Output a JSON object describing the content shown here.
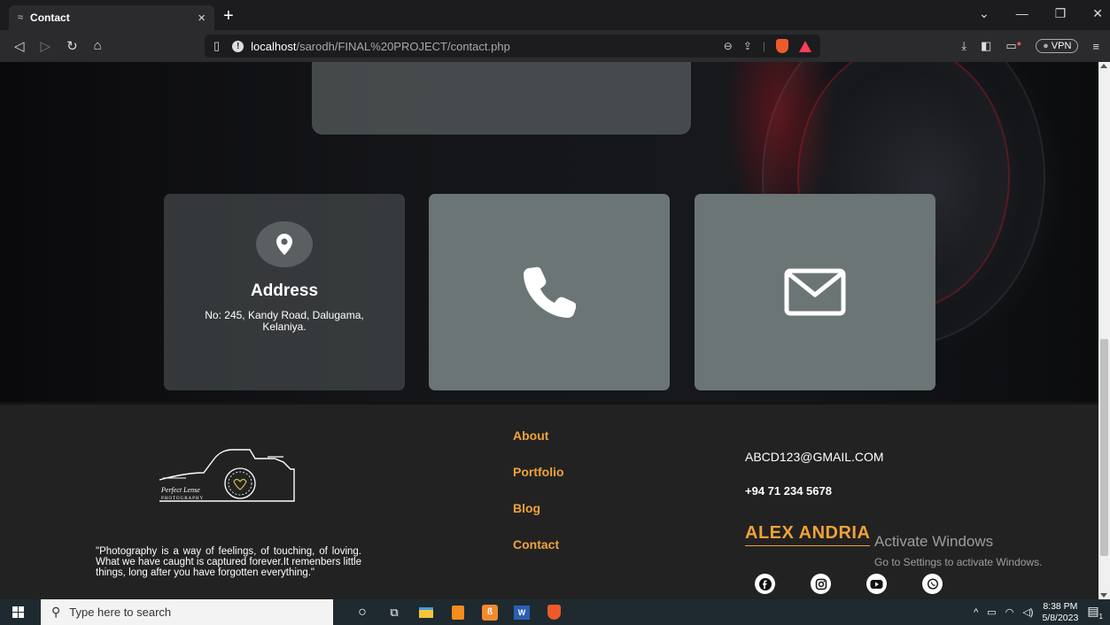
{
  "browser": {
    "tab_title": "Contact",
    "tab_close": "×",
    "new_tab": "+",
    "url_host": "localhost",
    "url_path": "/sarodh/FINAL%20PROJECT/contact.php",
    "vpn_label": "VPN",
    "window_controls": [
      "minimize-icon",
      "restore-icon",
      "close-icon"
    ]
  },
  "contact_cards": {
    "address_title": "Address",
    "address_text": "No: 245, Kandy Road, Dalugama, Kelaniya."
  },
  "footer": {
    "quote": "\"Photography is a way of feelings, of touching, of loving. What we have caught is captured forever.It remenbers little things, long after you have forgotten everything.\"",
    "links": [
      "About",
      "Portfolio",
      "Blog",
      "Contact"
    ],
    "email": "ABCD123@GMAIL.COM",
    "phone": "+94 71 234 5678",
    "brand": "ALEX ANDRIA",
    "logo_text_1": "Perfect Lense",
    "logo_text_2": "PHOTOGRAPHY",
    "socials": [
      "facebook-icon",
      "instagram-icon",
      "youtube-icon",
      "whatsapp-icon"
    ]
  },
  "watermark": {
    "line1": "Activate Windows",
    "line2": "Go to Settings to activate Windows."
  },
  "taskbar": {
    "search_placeholder": "Type here to search",
    "time": "8:38 PM",
    "date": "5/8/2023",
    "notification_count": "1"
  },
  "colors": {
    "accent": "#f0a23a",
    "card": "#6b7575",
    "footer_bg": "#222222"
  }
}
